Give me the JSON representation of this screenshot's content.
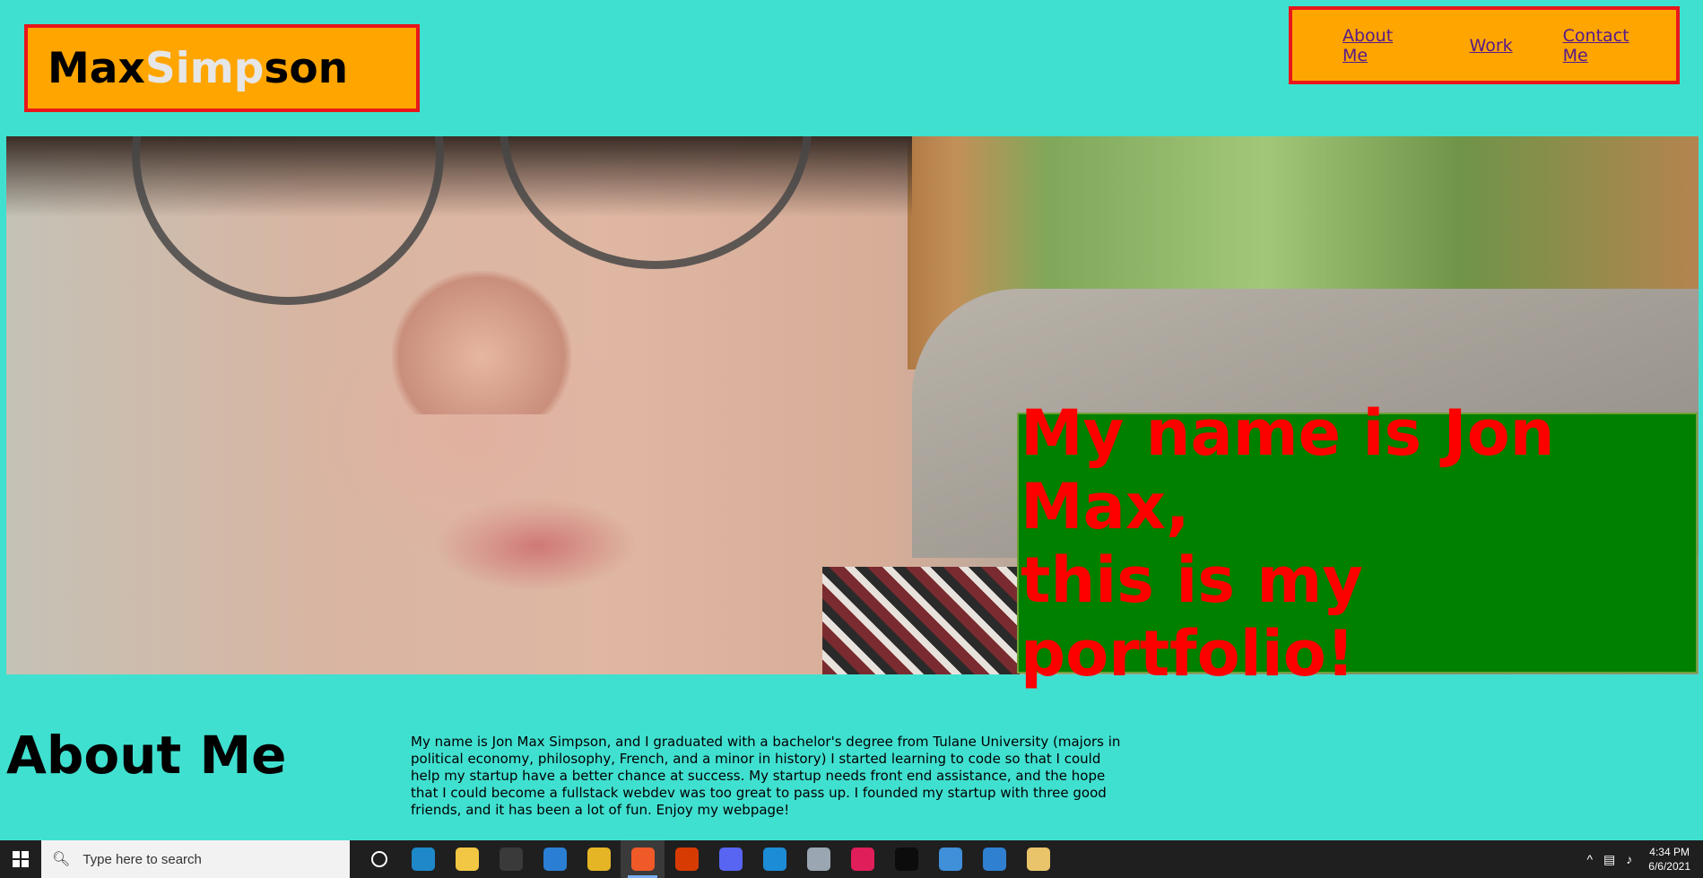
{
  "header": {
    "logo_part1": "Max ",
    "logo_part2": "Simp",
    "logo_part3": "son"
  },
  "nav": {
    "items": [
      {
        "label": "About Me"
      },
      {
        "label": "Work"
      },
      {
        "label": "Contact Me"
      }
    ]
  },
  "hero": {
    "line1": "My name is Jon Max,",
    "line2": "this is my portfolio!"
  },
  "about": {
    "title": "About Me",
    "body": "My name is Jon Max Simpson, and I graduated with a bachelor's degree from Tulane University (majors in political economy, philosophy, French, and a minor in history) I started learning to code so that I could help my startup have a better chance at success. My startup needs front end assistance, and the hope that I could become a fullstack webdev was too great to pass up. I founded my startup with three good friends, and it has been a lot of fun. Enjoy my webpage!"
  },
  "taskbar": {
    "search_placeholder": "Type here to search",
    "time": "4:34 PM",
    "date": "6/6/2021",
    "apps": [
      {
        "icon": "cortana-icon",
        "color": "#1f1f1f"
      },
      {
        "icon": "edge-icon",
        "color": "#1e88c9"
      },
      {
        "icon": "file-explorer-icon",
        "color": "#f2c744"
      },
      {
        "icon": "store-icon",
        "color": "#3a3a3a"
      },
      {
        "icon": "mail-icon",
        "color": "#2a7fd4"
      },
      {
        "icon": "chrome-icon",
        "color": "#e5b526"
      },
      {
        "icon": "brave-icon",
        "color": "#f05a28"
      },
      {
        "icon": "office-icon",
        "color": "#d83b01"
      },
      {
        "icon": "discord-icon",
        "color": "#5865f2"
      },
      {
        "icon": "vscode-icon",
        "color": "#1c8cd6"
      },
      {
        "icon": "pictures-icon",
        "color": "#9aa6b2"
      },
      {
        "icon": "slack-icon",
        "color": "#e01e5a"
      },
      {
        "icon": "terminal-icon",
        "color": "#0c0c0c"
      },
      {
        "icon": "git-icon",
        "color": "#3f8fd9"
      },
      {
        "icon": "photos-icon",
        "color": "#2f80d1"
      },
      {
        "icon": "paint-icon",
        "color": "#e9c46a"
      }
    ]
  }
}
